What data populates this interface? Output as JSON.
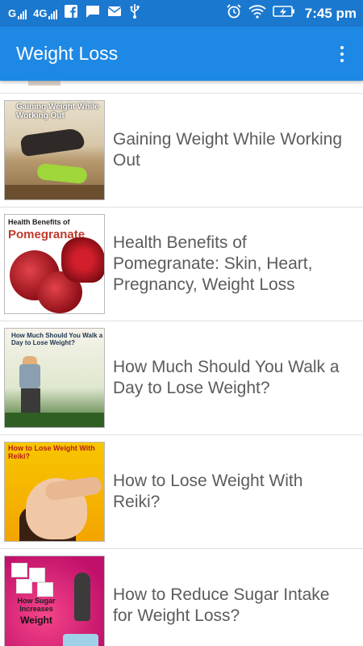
{
  "status_bar": {
    "network_1": "G",
    "network_2": "4G",
    "time": "7:45 pm",
    "icons": [
      "signal-bars",
      "facebook-icon",
      "message-icon",
      "mail-icon",
      "usb-icon",
      "alarm-icon",
      "wifi-icon",
      "battery-charging-icon"
    ]
  },
  "app_bar": {
    "title": "Weight Loss",
    "menu_icon": "overflow-menu-icon"
  },
  "colors": {
    "status_bar": "#1b78cf",
    "app_bar": "#1e88e5",
    "title_text": "#5c5c5c"
  },
  "articles": [
    {
      "title": "Gaining Weight While Working Out",
      "thumb_caption": "Gaining Weight While Working Out"
    },
    {
      "title": "Health Benefits of Pomegranate: Skin, Heart, Pregnancy, Weight Loss",
      "thumb_caption_1": "Health Benefits of",
      "thumb_caption_2": "Pomegranate"
    },
    {
      "title": "How Much Should You Walk a Day to Lose Weight?",
      "thumb_caption": "How Much Should You Walk a Day to Lose Weight?"
    },
    {
      "title": "How to Lose Weight With Reiki?",
      "thumb_caption": "How to Lose Weight With Reiki?"
    },
    {
      "title": "How to Reduce Sugar Intake for Weight Loss?",
      "thumb_caption_1": "How Sugar Increases",
      "thumb_caption_2": "Weight"
    }
  ]
}
